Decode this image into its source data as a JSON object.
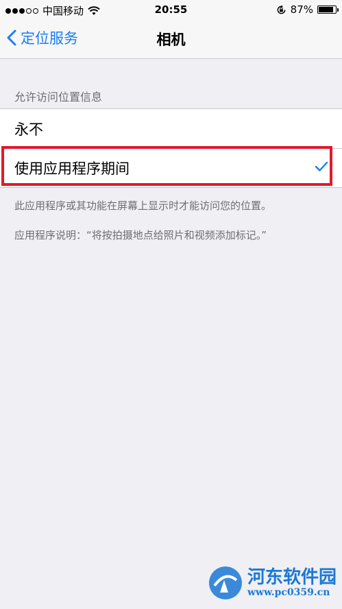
{
  "status_bar": {
    "carrier": "中国移动",
    "time": "20:55",
    "battery": "87%",
    "battery_level": 0.87,
    "signal_full": 3,
    "signal_total": 5
  },
  "nav": {
    "back_label": "定位服务",
    "title": "相机"
  },
  "section": {
    "header": "允许访问位置信息",
    "options": [
      {
        "label": "永不",
        "selected": false
      },
      {
        "label": "使用应用程序期间",
        "selected": true
      }
    ]
  },
  "footer": {
    "note": "此应用程序或其功能在屏幕上显示时才能访问您的位置。",
    "description": "应用程序说明：“将按拍摄地点给照片和视频添加标记。”"
  },
  "watermark": {
    "title": "河东软件园",
    "url": "www.pc0359.cn"
  },
  "colors": {
    "accent": "#1a7cf5",
    "highlight": "#e0192b",
    "background": "#efeff4"
  }
}
